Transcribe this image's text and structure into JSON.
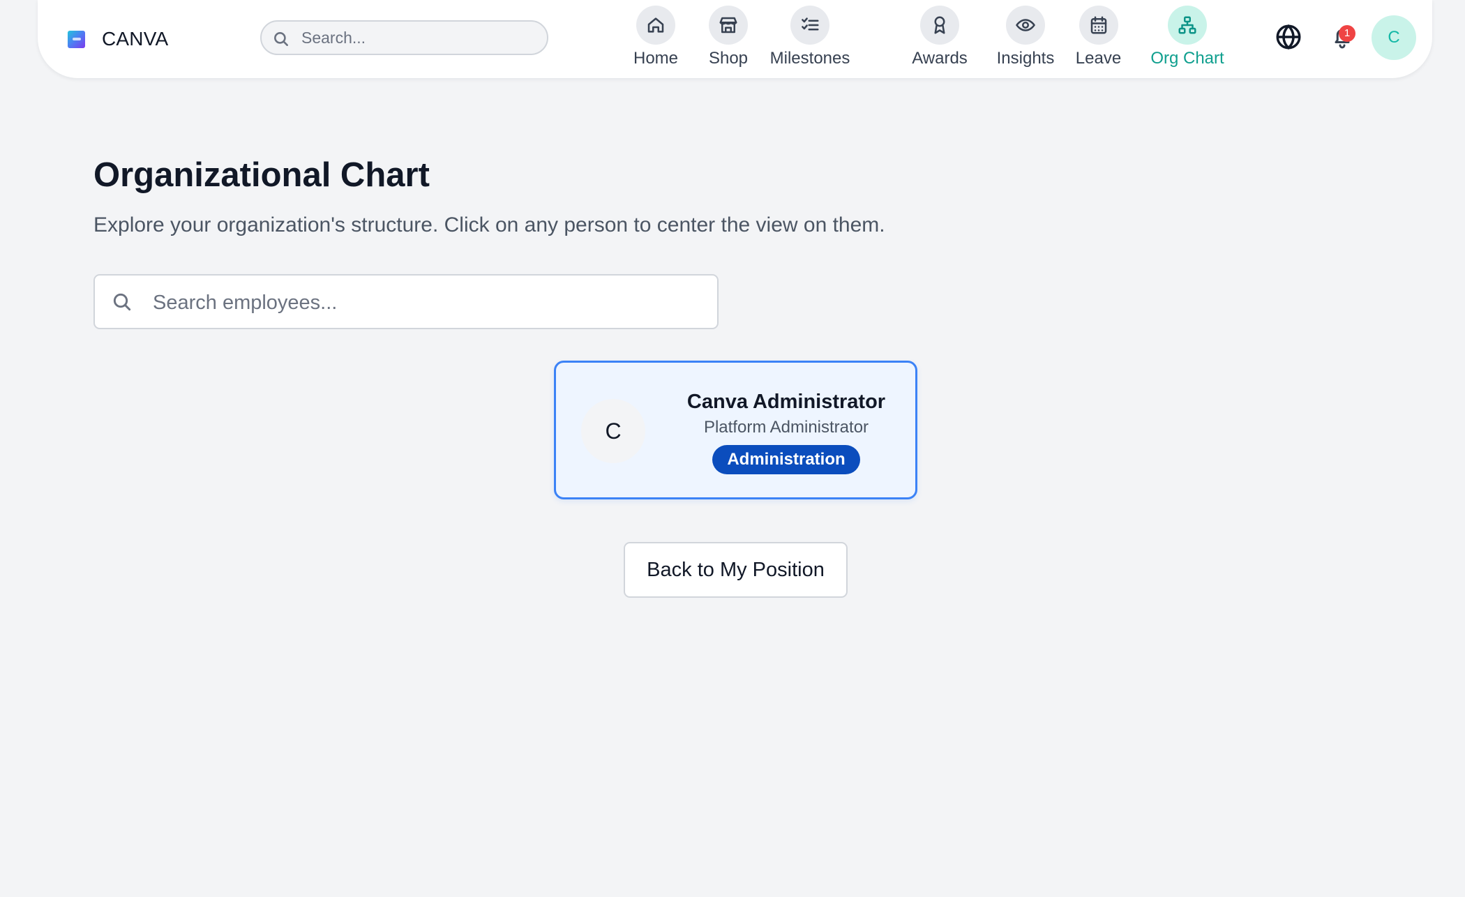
{
  "brand": {
    "name": "CANVA"
  },
  "topbar": {
    "search_placeholder": "Search..."
  },
  "navigation": {
    "items": [
      {
        "label": "Home",
        "icon": "home-icon"
      },
      {
        "label": "Shop",
        "icon": "store-icon"
      },
      {
        "label": "Milestones",
        "icon": "checklist-icon"
      },
      {
        "label": "Awards",
        "icon": "award-icon"
      },
      {
        "label": "Insights",
        "icon": "eye-icon"
      },
      {
        "label": "Leave",
        "icon": "calendar-icon"
      },
      {
        "label": "Org Chart",
        "icon": "org-chart-icon",
        "active": true
      }
    ]
  },
  "header_actions": {
    "language_icon": "globe-icon",
    "notifications_icon": "bell-icon",
    "notification_count": "1",
    "user_initial": "C"
  },
  "page": {
    "title": "Organizational Chart",
    "subtitle": "Explore your organization's structure. Click on any person to center the view on them.",
    "employee_search_placeholder": "Search employees..."
  },
  "org_chart": {
    "selected_person": {
      "initial": "C",
      "name": "Canva Administrator",
      "role": "Platform Administrator",
      "department": "Administration"
    },
    "back_button_label": "Back to My Position"
  },
  "colors": {
    "background": "#f3f4f6",
    "accent": "#0f9f8e",
    "selected_card_border": "#3b82f6",
    "department_badge": "#0b4dbd",
    "notification_badge": "#ef4444"
  }
}
